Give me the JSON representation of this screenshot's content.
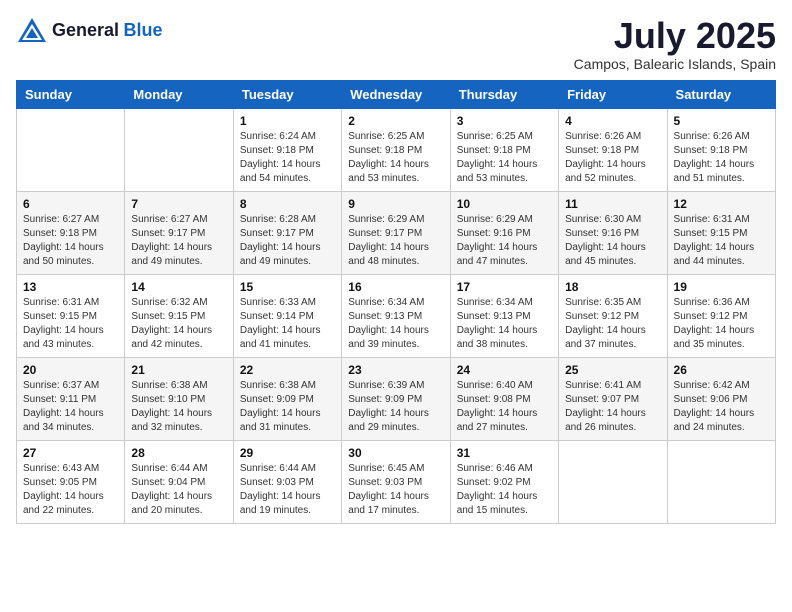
{
  "logo": {
    "general": "General",
    "blue": "Blue"
  },
  "title": "July 2025",
  "subtitle": "Campos, Balearic Islands, Spain",
  "weekdays": [
    "Sunday",
    "Monday",
    "Tuesday",
    "Wednesday",
    "Thursday",
    "Friday",
    "Saturday"
  ],
  "weeks": [
    [
      {
        "day": "",
        "sunrise": "",
        "sunset": "",
        "daylight": ""
      },
      {
        "day": "",
        "sunrise": "",
        "sunset": "",
        "daylight": ""
      },
      {
        "day": "1",
        "sunrise": "Sunrise: 6:24 AM",
        "sunset": "Sunset: 9:18 PM",
        "daylight": "Daylight: 14 hours and 54 minutes."
      },
      {
        "day": "2",
        "sunrise": "Sunrise: 6:25 AM",
        "sunset": "Sunset: 9:18 PM",
        "daylight": "Daylight: 14 hours and 53 minutes."
      },
      {
        "day": "3",
        "sunrise": "Sunrise: 6:25 AM",
        "sunset": "Sunset: 9:18 PM",
        "daylight": "Daylight: 14 hours and 53 minutes."
      },
      {
        "day": "4",
        "sunrise": "Sunrise: 6:26 AM",
        "sunset": "Sunset: 9:18 PM",
        "daylight": "Daylight: 14 hours and 52 minutes."
      },
      {
        "day": "5",
        "sunrise": "Sunrise: 6:26 AM",
        "sunset": "Sunset: 9:18 PM",
        "daylight": "Daylight: 14 hours and 51 minutes."
      }
    ],
    [
      {
        "day": "6",
        "sunrise": "Sunrise: 6:27 AM",
        "sunset": "Sunset: 9:18 PM",
        "daylight": "Daylight: 14 hours and 50 minutes."
      },
      {
        "day": "7",
        "sunrise": "Sunrise: 6:27 AM",
        "sunset": "Sunset: 9:17 PM",
        "daylight": "Daylight: 14 hours and 49 minutes."
      },
      {
        "day": "8",
        "sunrise": "Sunrise: 6:28 AM",
        "sunset": "Sunset: 9:17 PM",
        "daylight": "Daylight: 14 hours and 49 minutes."
      },
      {
        "day": "9",
        "sunrise": "Sunrise: 6:29 AM",
        "sunset": "Sunset: 9:17 PM",
        "daylight": "Daylight: 14 hours and 48 minutes."
      },
      {
        "day": "10",
        "sunrise": "Sunrise: 6:29 AM",
        "sunset": "Sunset: 9:16 PM",
        "daylight": "Daylight: 14 hours and 47 minutes."
      },
      {
        "day": "11",
        "sunrise": "Sunrise: 6:30 AM",
        "sunset": "Sunset: 9:16 PM",
        "daylight": "Daylight: 14 hours and 45 minutes."
      },
      {
        "day": "12",
        "sunrise": "Sunrise: 6:31 AM",
        "sunset": "Sunset: 9:15 PM",
        "daylight": "Daylight: 14 hours and 44 minutes."
      }
    ],
    [
      {
        "day": "13",
        "sunrise": "Sunrise: 6:31 AM",
        "sunset": "Sunset: 9:15 PM",
        "daylight": "Daylight: 14 hours and 43 minutes."
      },
      {
        "day": "14",
        "sunrise": "Sunrise: 6:32 AM",
        "sunset": "Sunset: 9:15 PM",
        "daylight": "Daylight: 14 hours and 42 minutes."
      },
      {
        "day": "15",
        "sunrise": "Sunrise: 6:33 AM",
        "sunset": "Sunset: 9:14 PM",
        "daylight": "Daylight: 14 hours and 41 minutes."
      },
      {
        "day": "16",
        "sunrise": "Sunrise: 6:34 AM",
        "sunset": "Sunset: 9:13 PM",
        "daylight": "Daylight: 14 hours and 39 minutes."
      },
      {
        "day": "17",
        "sunrise": "Sunrise: 6:34 AM",
        "sunset": "Sunset: 9:13 PM",
        "daylight": "Daylight: 14 hours and 38 minutes."
      },
      {
        "day": "18",
        "sunrise": "Sunrise: 6:35 AM",
        "sunset": "Sunset: 9:12 PM",
        "daylight": "Daylight: 14 hours and 37 minutes."
      },
      {
        "day": "19",
        "sunrise": "Sunrise: 6:36 AM",
        "sunset": "Sunset: 9:12 PM",
        "daylight": "Daylight: 14 hours and 35 minutes."
      }
    ],
    [
      {
        "day": "20",
        "sunrise": "Sunrise: 6:37 AM",
        "sunset": "Sunset: 9:11 PM",
        "daylight": "Daylight: 14 hours and 34 minutes."
      },
      {
        "day": "21",
        "sunrise": "Sunrise: 6:38 AM",
        "sunset": "Sunset: 9:10 PM",
        "daylight": "Daylight: 14 hours and 32 minutes."
      },
      {
        "day": "22",
        "sunrise": "Sunrise: 6:38 AM",
        "sunset": "Sunset: 9:09 PM",
        "daylight": "Daylight: 14 hours and 31 minutes."
      },
      {
        "day": "23",
        "sunrise": "Sunrise: 6:39 AM",
        "sunset": "Sunset: 9:09 PM",
        "daylight": "Daylight: 14 hours and 29 minutes."
      },
      {
        "day": "24",
        "sunrise": "Sunrise: 6:40 AM",
        "sunset": "Sunset: 9:08 PM",
        "daylight": "Daylight: 14 hours and 27 minutes."
      },
      {
        "day": "25",
        "sunrise": "Sunrise: 6:41 AM",
        "sunset": "Sunset: 9:07 PM",
        "daylight": "Daylight: 14 hours and 26 minutes."
      },
      {
        "day": "26",
        "sunrise": "Sunrise: 6:42 AM",
        "sunset": "Sunset: 9:06 PM",
        "daylight": "Daylight: 14 hours and 24 minutes."
      }
    ],
    [
      {
        "day": "27",
        "sunrise": "Sunrise: 6:43 AM",
        "sunset": "Sunset: 9:05 PM",
        "daylight": "Daylight: 14 hours and 22 minutes."
      },
      {
        "day": "28",
        "sunrise": "Sunrise: 6:44 AM",
        "sunset": "Sunset: 9:04 PM",
        "daylight": "Daylight: 14 hours and 20 minutes."
      },
      {
        "day": "29",
        "sunrise": "Sunrise: 6:44 AM",
        "sunset": "Sunset: 9:03 PM",
        "daylight": "Daylight: 14 hours and 19 minutes."
      },
      {
        "day": "30",
        "sunrise": "Sunrise: 6:45 AM",
        "sunset": "Sunset: 9:03 PM",
        "daylight": "Daylight: 14 hours and 17 minutes."
      },
      {
        "day": "31",
        "sunrise": "Sunrise: 6:46 AM",
        "sunset": "Sunset: 9:02 PM",
        "daylight": "Daylight: 14 hours and 15 minutes."
      },
      {
        "day": "",
        "sunrise": "",
        "sunset": "",
        "daylight": ""
      },
      {
        "day": "",
        "sunrise": "",
        "sunset": "",
        "daylight": ""
      }
    ]
  ]
}
